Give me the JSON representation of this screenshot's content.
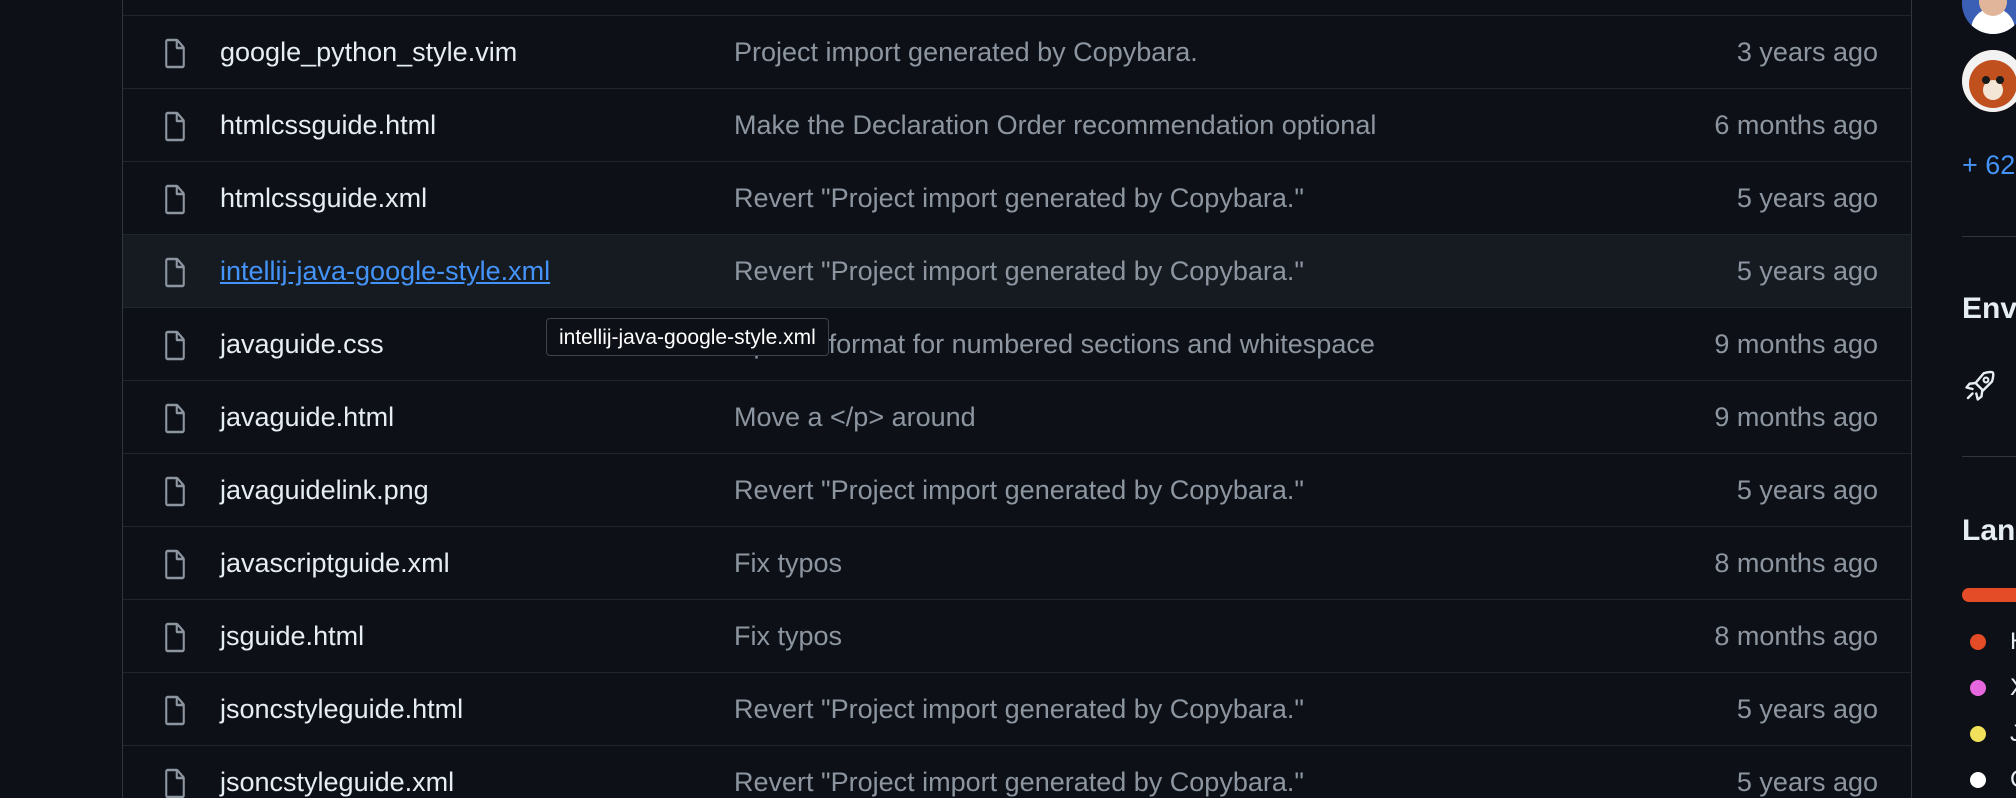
{
  "files": [
    {
      "name": "google_python_style.vim",
      "message": "Project import generated by Copybara.",
      "time": "3 years ago"
    },
    {
      "name": "htmlcssguide.html",
      "message": "Make the Declaration Order recommendation optional",
      "time": "6 months ago"
    },
    {
      "name": "htmlcssguide.xml",
      "message": "Revert \"Project import generated by Copybara.\"",
      "time": "5 years ago"
    },
    {
      "name": "intellij-java-google-style.xml",
      "message": "Revert \"Project import generated by Copybara.\"",
      "time": "5 years ago"
    },
    {
      "name": "javaguide.css",
      "message": "Update format for numbered sections and whitespace",
      "time": "9 months ago"
    },
    {
      "name": "javaguide.html",
      "message": "Move a </p> around",
      "time": "9 months ago"
    },
    {
      "name": "javaguidelink.png",
      "message": "Revert \"Project import generated by Copybara.\"",
      "time": "5 years ago"
    },
    {
      "name": "javascriptguide.xml",
      "message": "Fix typos",
      "time": "8 months ago"
    },
    {
      "name": "jsguide.html",
      "message": "Fix typos",
      "time": "8 months ago"
    },
    {
      "name": "jsoncstyleguide.html",
      "message": "Revert \"Project import generated by Copybara.\"",
      "time": "5 years ago"
    },
    {
      "name": "jsoncstyleguide.xml",
      "message": "Revert \"Project import generated by Copybara.\"",
      "time": "5 years ago"
    }
  ],
  "hovered_row": 3,
  "tooltip": {
    "text": "intellij-java-google-style.xml"
  },
  "sidebar": {
    "contributors_more": "+ 62",
    "environments_heading": "Env",
    "languages_heading": "Lan",
    "languages": [
      {
        "label": "H",
        "color": "#e34c26"
      },
      {
        "label": "X",
        "color": "#e768de"
      },
      {
        "label": "J",
        "color": "#f1e05a"
      },
      {
        "label": "C",
        "color": "#ffffff"
      }
    ]
  },
  "colors": {
    "background": "#0d1117",
    "link": "#4493f8",
    "muted_text": "#8d96a0",
    "primary_text": "#e6edf3"
  }
}
